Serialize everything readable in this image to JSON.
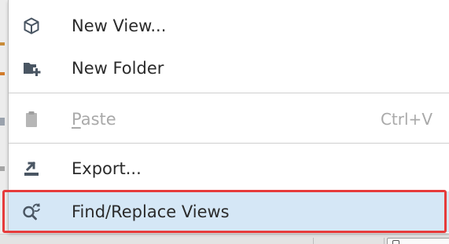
{
  "context_menu": {
    "items": [
      {
        "label": "New View...",
        "icon": "cube-icon",
        "enabled": true
      },
      {
        "label": "New Folder",
        "icon": "folder-add-icon",
        "enabled": true
      },
      {
        "label_prefix": "",
        "label_mnemonic": "P",
        "label_rest": "aste",
        "shortcut": "Ctrl+V",
        "icon": "clipboard-icon",
        "enabled": false
      },
      {
        "label": "Export...",
        "icon": "export-icon",
        "enabled": true
      },
      {
        "label": "Find/Replace Views",
        "icon": "find-replace-icon",
        "enabled": true,
        "highlighted": true
      }
    ],
    "colors": {
      "highlight_background": "#d5e7f6",
      "highlight_border": "#e63b3b",
      "icon": "#4a5663",
      "disabled_text": "#a9a9a9"
    }
  }
}
